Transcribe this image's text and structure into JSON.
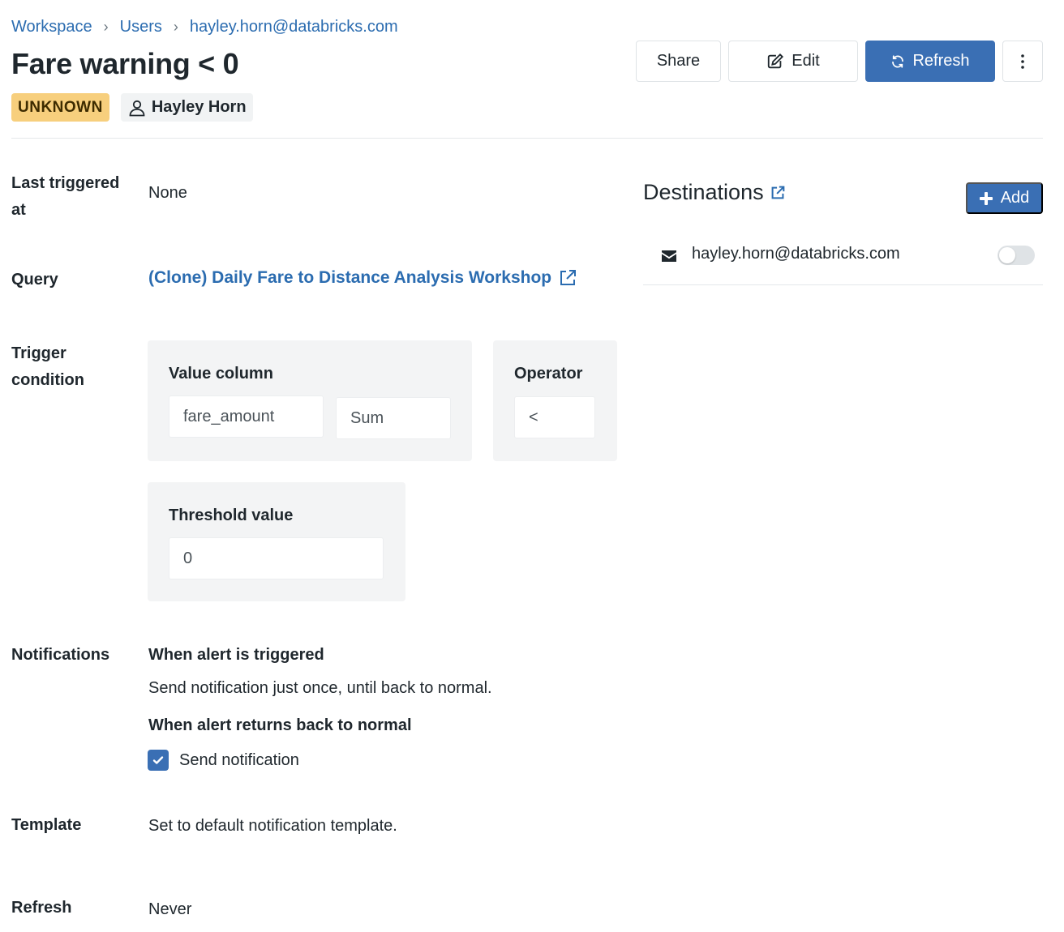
{
  "breadcrumb": {
    "items": [
      "Workspace",
      "Users",
      "hayley.horn@databricks.com"
    ],
    "separator": "›"
  },
  "title": "Fare warning < 0",
  "status_badge": "UNKNOWN",
  "owner": "Hayley Horn",
  "toolbar": {
    "share": "Share",
    "edit": "Edit",
    "refresh": "Refresh",
    "more_icon": "kebab-vertical-icon"
  },
  "details": {
    "last_triggered_label_1": "Last triggered",
    "last_triggered_label_2": "at",
    "last_triggered_value": "None",
    "query_label": "Query",
    "query_value": "(Clone) Daily Fare to Distance Analysis Workshop",
    "trigger_label_1": "Trigger",
    "trigger_label_2": "condition",
    "value_column_title": "Value column",
    "value_column": "fare_amount",
    "aggregation": "Sum",
    "operator_title": "Operator",
    "operator": "<",
    "threshold_title": "Threshold value",
    "threshold": "0",
    "notifications_label": "Notifications",
    "when_triggered": "When alert is triggered",
    "when_triggered_text": "Send notification just once, until back to normal.",
    "when_normal": "When alert returns back to normal",
    "send_notification": "Send notification",
    "send_notification_checked": true,
    "template_label": "Template",
    "template_value": "Set to default notification template.",
    "refresh_label": "Refresh",
    "refresh_value": "Never"
  },
  "destinations": {
    "title": "Destinations",
    "add_label": "Add",
    "items": [
      {
        "email": "hayley.horn@databricks.com",
        "enabled": false
      }
    ]
  },
  "colors": {
    "accent": "#3a6fb4",
    "link": "#2b6cb0",
    "status_unknown": "#f7cf7d"
  }
}
